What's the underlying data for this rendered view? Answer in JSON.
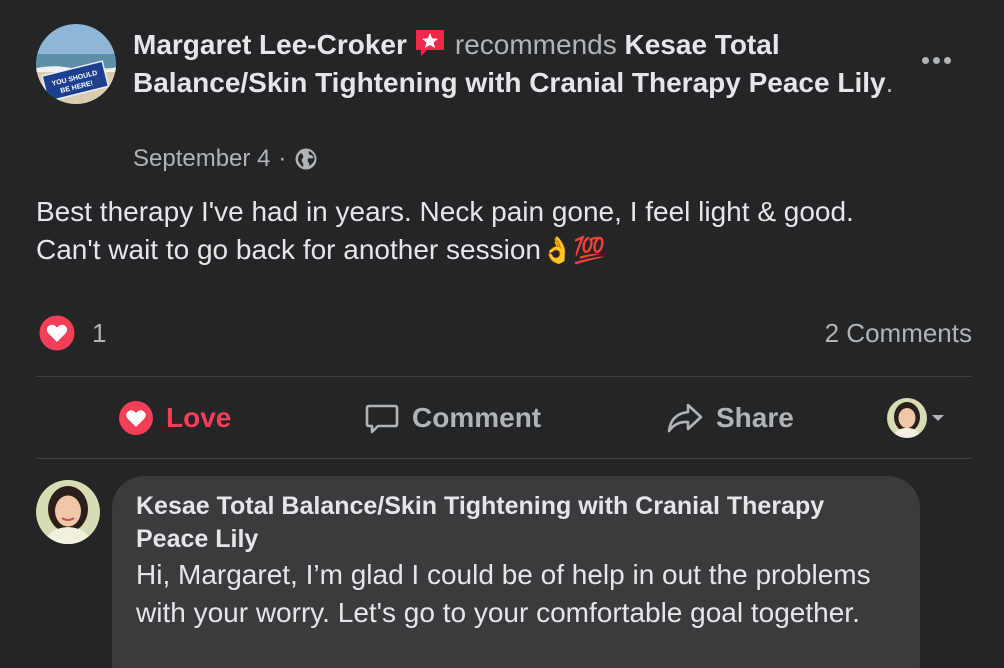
{
  "post": {
    "author": "Margaret Lee-Croker",
    "verb": "recommends",
    "page_name": "Kesae Total Balance/Skin Tightening with Cranial Therapy Peace Lily",
    "period": ".",
    "date": "September 4",
    "separator": "·",
    "privacy_icon": "globe-icon",
    "avatar_sign_text": "YOU SHOULD BE HERE!",
    "text_line1": "Best therapy I've had in years. Neck pain gone, I feel light & good.",
    "text_line2": "Can't wait to go back for another session",
    "emoji": "👌💯"
  },
  "stats": {
    "reaction_icon": "heart-icon",
    "reaction_count": "1",
    "comments": "2 Comments"
  },
  "actions": {
    "love": "Love",
    "comment": "Comment",
    "share": "Share"
  },
  "comment": {
    "author": "Kesae Total Balance/Skin Tightening with Cranial Therapy Peace Lily",
    "text": "Hi, Margaret, I’m glad I could be of help in out the problems with your worry. Let's go to your comfortable goal together."
  },
  "colors": {
    "background": "#242526",
    "love": "#f33e58",
    "bubble": "#3a3b3c",
    "recommend_badge": "#f02849"
  }
}
